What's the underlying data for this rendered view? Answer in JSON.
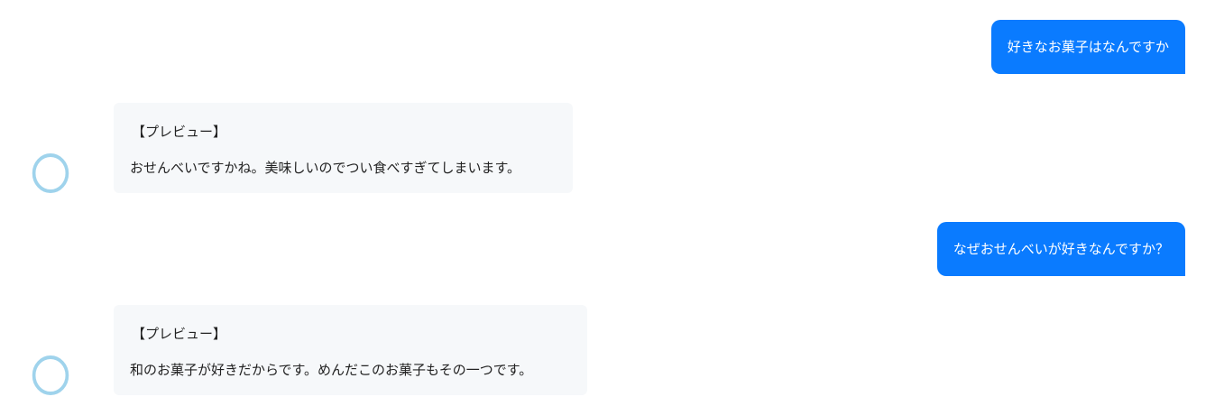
{
  "colors": {
    "user_bubble": "#0a7bff",
    "bot_bubble": "#f6f8fa",
    "avatar_ring": "#9fd3ec"
  },
  "messages": [
    {
      "role": "user",
      "text": "好きなお菓子はなんですか"
    },
    {
      "role": "bot",
      "label": "【プレビュー】",
      "text": "おせんべいですかね。美味しいのでつい食べすぎてしまいます。",
      "avatar_icon": "ring-avatar-icon"
    },
    {
      "role": "user",
      "text": "なぜおせんべいが好きなんですか？"
    },
    {
      "role": "bot",
      "label": "【プレビュー】",
      "text": "和のお菓子が好きだからです。めんだこのお菓子もその一つです。",
      "avatar_icon": "ring-avatar-icon"
    }
  ]
}
